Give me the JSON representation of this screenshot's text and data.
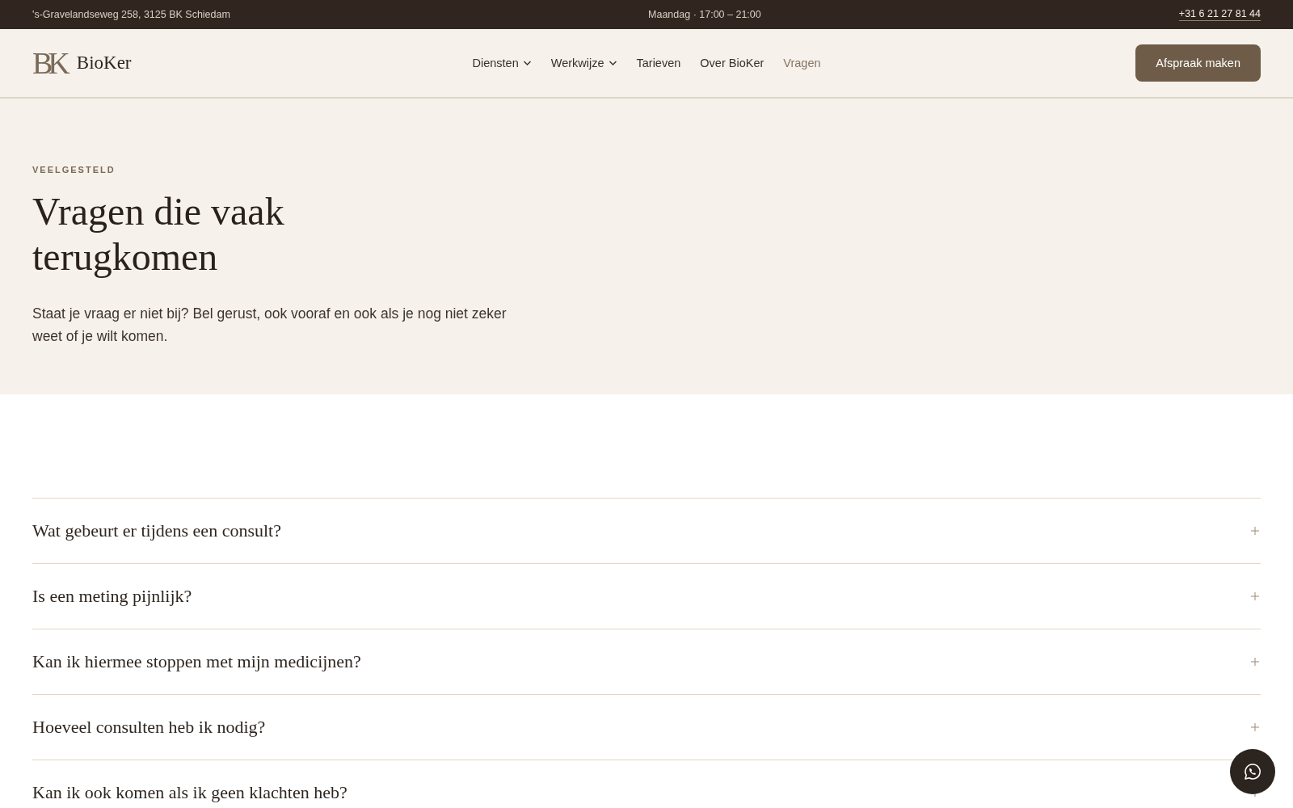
{
  "top_bar": {
    "address": "'s-Gravelandseweg 258, 3125 BK Schiedam",
    "hours": "Maandag · 17:00 – 21:00",
    "phone": "+31 6 21 27 81 44"
  },
  "header": {
    "logo_mark": "BK",
    "logo_text": "BioKer",
    "nav": [
      {
        "label": "Diensten",
        "kind": "dropdown",
        "selected": false
      },
      {
        "label": "Werkwijze",
        "kind": "dropdown",
        "selected": false
      },
      {
        "label": "Tarieven",
        "kind": "link",
        "selected": false
      },
      {
        "label": "Over BioKer",
        "kind": "link",
        "selected": false
      },
      {
        "label": "Vragen",
        "kind": "link",
        "selected": true
      }
    ],
    "cta": "Afspraak maken"
  },
  "hero": {
    "eyebrow": "VEELGESTELD",
    "title_lines": [
      "Vragen die vaak",
      "terugkomen"
    ],
    "intro": "Staat je vraag er niet bij? Bel gerust, ook vooraf en ook als je nog niet zeker weet of je wilt komen."
  },
  "faq": [
    {
      "question": "Wat gebeurt er tijdens een consult?",
      "expanded": false
    },
    {
      "question": "Is een meting pijnlijk?",
      "expanded": false
    },
    {
      "question": "Kan ik hiermee stoppen met mijn medicijnen?",
      "expanded": false
    },
    {
      "question": "Hoeveel consulten heb ik nodig?",
      "expanded": false
    },
    {
      "question": "Kan ik ook komen als ik geen klachten heb?",
      "expanded": false
    }
  ]
}
